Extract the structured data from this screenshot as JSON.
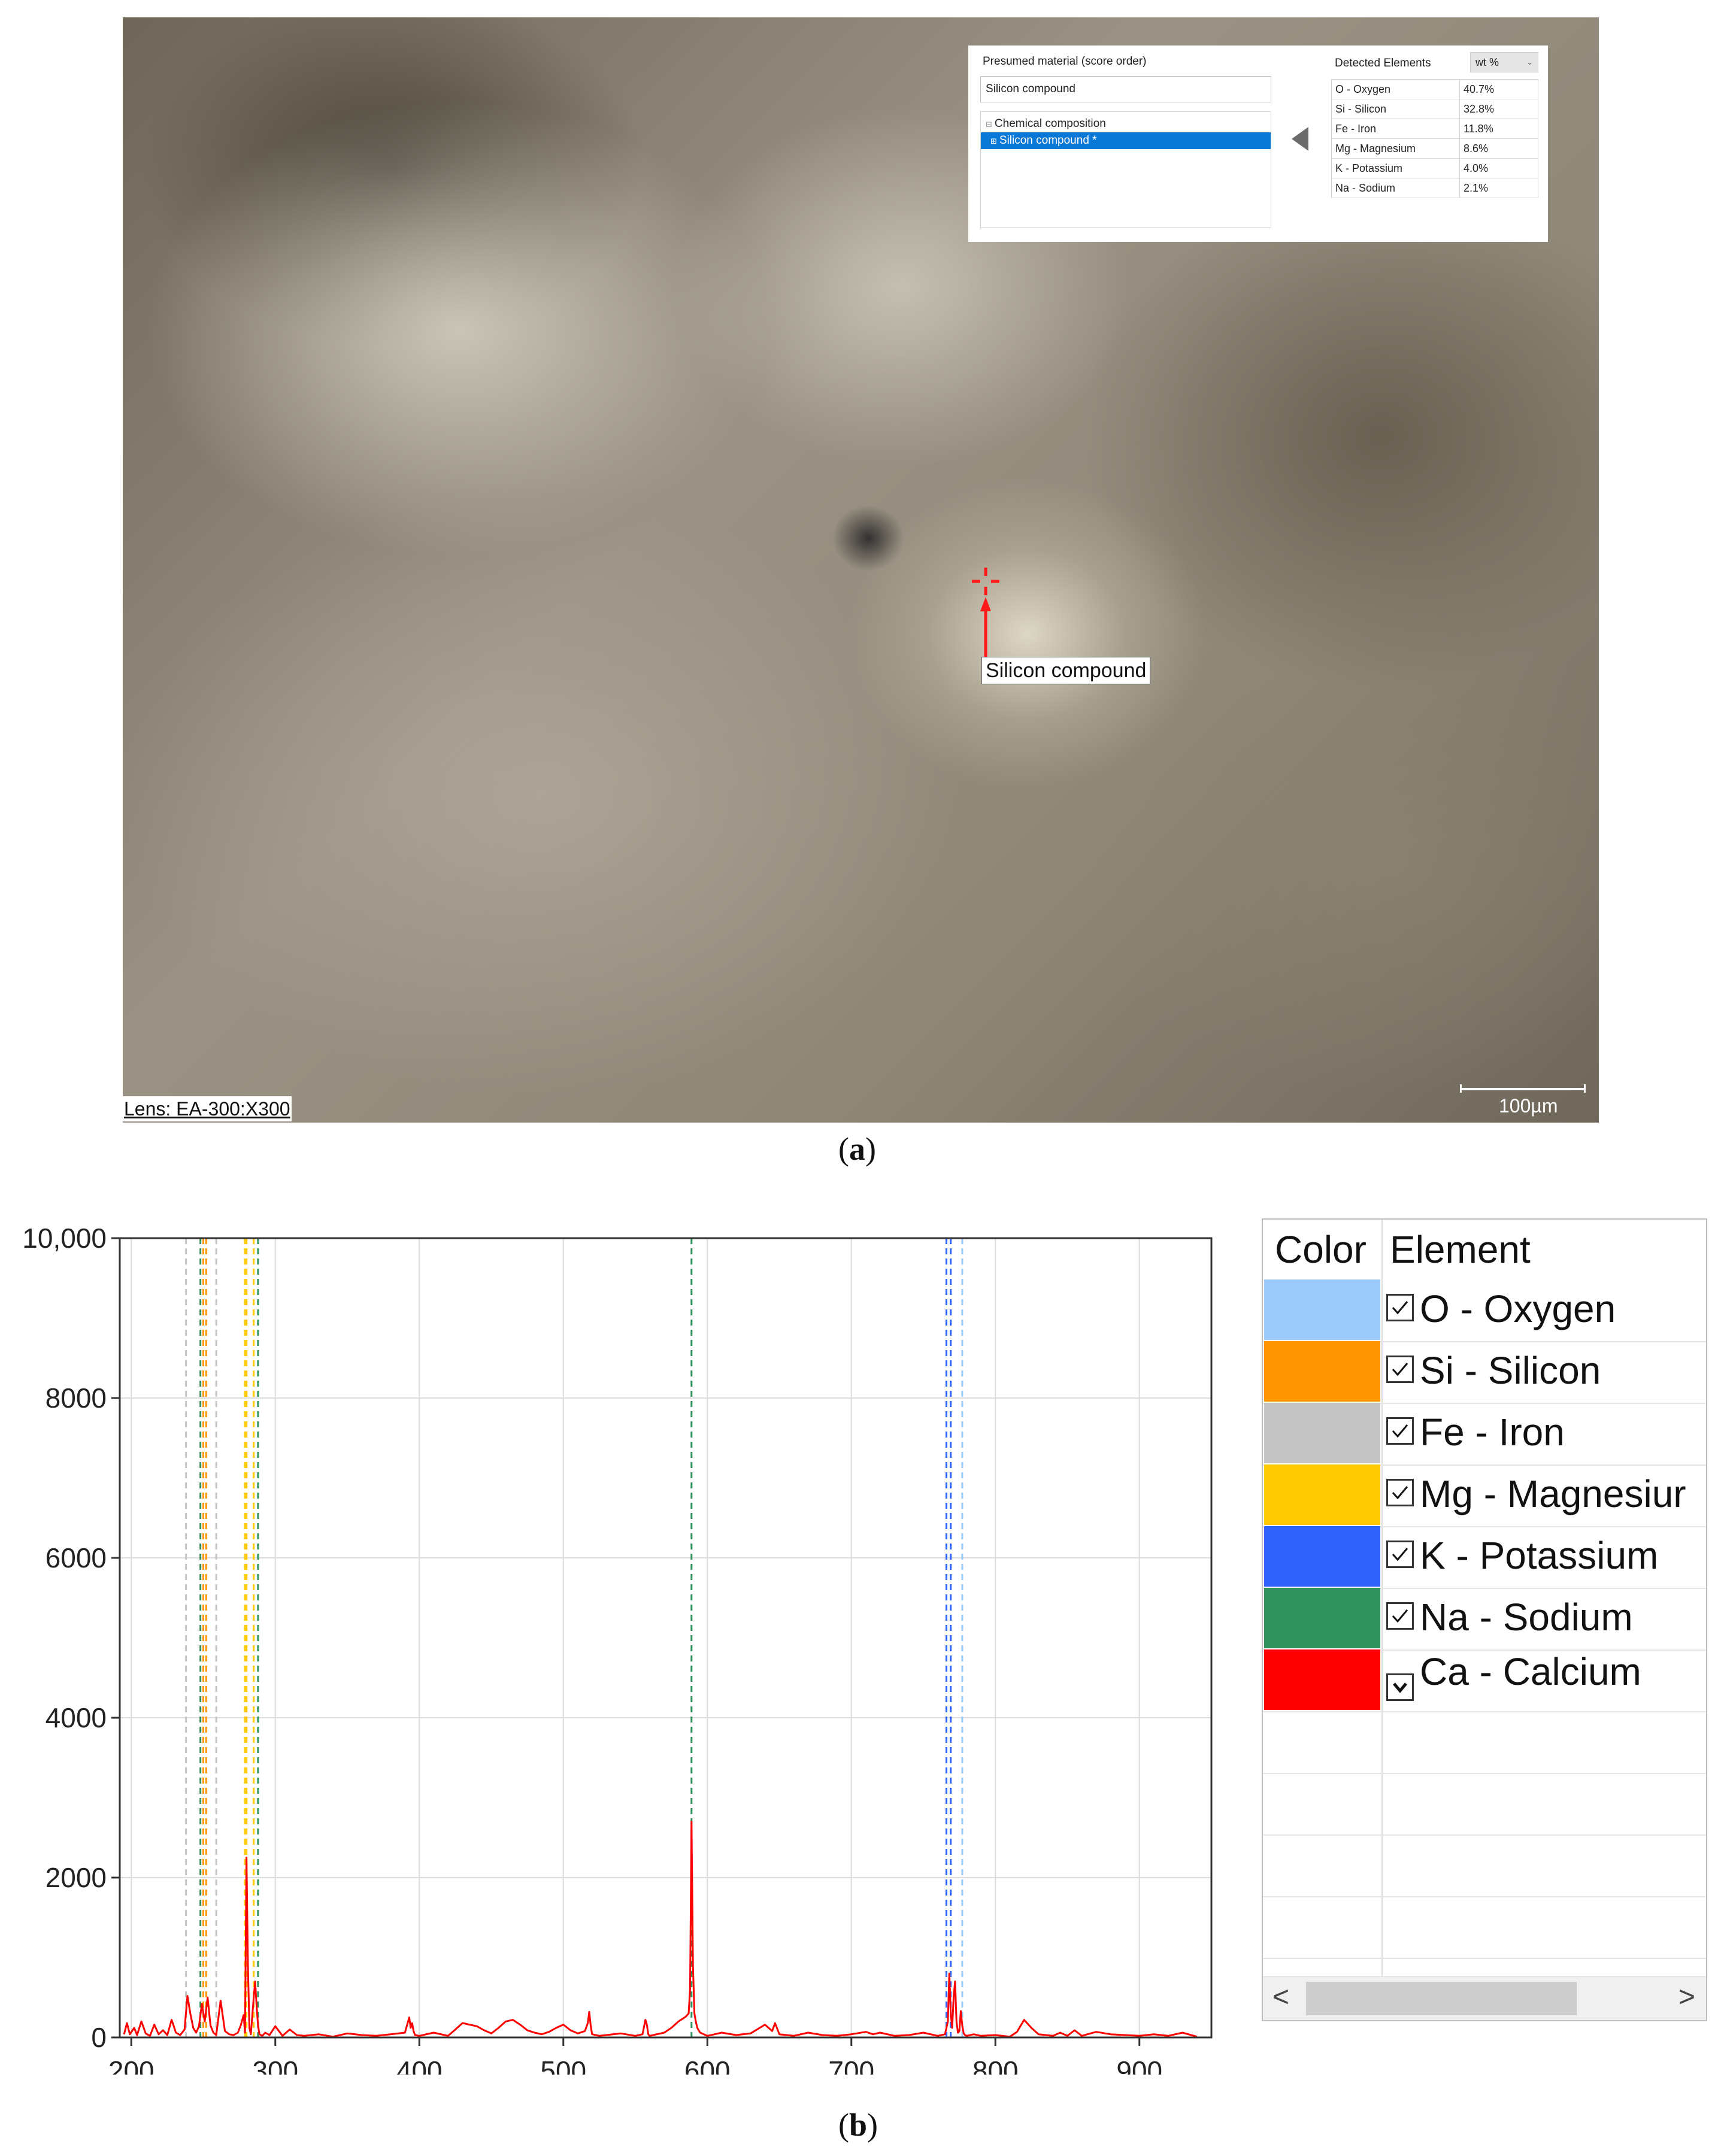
{
  "panel_a": {
    "label": "a",
    "material_panel": {
      "title": "Presumed material (score order)",
      "material_value": "Silicon compound",
      "tree_root": "Chemical composition",
      "tree_selected": "Silicon compound *",
      "detected_title": "Detected Elements",
      "unit": "wt %",
      "elements": [
        {
          "name": "O - Oxygen",
          "value": "40.7%"
        },
        {
          "name": "Si - Silicon",
          "value": "32.8%"
        },
        {
          "name": "Fe - Iron",
          "value": "11.8%"
        },
        {
          "name": "Mg - Magnesium",
          "value": "8.6%"
        },
        {
          "name": "K - Potassium",
          "value": "4.0%"
        },
        {
          "name": "Na - Sodium",
          "value": "2.1%"
        }
      ]
    },
    "annotation": "Silicon compound",
    "lens": "Lens: EA-300:X300",
    "scale": "100µm",
    "colors": {
      "target": "#ff1a1a",
      "selection": "#0a78d7"
    }
  },
  "panel_b": {
    "label": "b",
    "legend": {
      "header_color": "Color",
      "header_element": "Element",
      "rows": [
        {
          "name": "O - Oxygen",
          "color": "#9dcbf9",
          "checked": true
        },
        {
          "name": "Si - Silicon",
          "color": "#ff9500",
          "checked": true
        },
        {
          "name": "Fe - Iron",
          "color": "#c4c4c4",
          "checked": true
        },
        {
          "name": "Mg - Magnesiur",
          "color": "#ffcb00",
          "checked": true
        },
        {
          "name": "K - Potassium",
          "color": "#2f62fb",
          "checked": true
        },
        {
          "name": "Na - Sodium",
          "color": "#30935d",
          "checked": true
        },
        {
          "name": "Ca - Calcium",
          "color": "#ff0000",
          "checked": "expand"
        }
      ],
      "scroll_left": "<",
      "scroll_right": ">"
    }
  },
  "chart_data": {
    "type": "line",
    "title": "",
    "xlabel": "",
    "ylabel": "",
    "xlim": [
      192,
      950
    ],
    "ylim": [
      0,
      10000
    ],
    "x_ticks": [
      200,
      300,
      400,
      500,
      600,
      700,
      800,
      900
    ],
    "y_ticks": [
      0,
      2000,
      4000,
      6000,
      8000,
      10000
    ],
    "x_tick_labels": [
      "200",
      "300",
      "400",
      "500",
      "600",
      "700",
      "800",
      "900"
    ],
    "y_tick_labels": [
      "0",
      "2000",
      "4000",
      "6000",
      "8000",
      "10,000"
    ],
    "grid": true,
    "series": [
      {
        "name": "Ca - Calcium",
        "color": "#ff0000",
        "x": [
          195,
          197,
          199,
          202,
          204,
          207,
          210,
          213,
          216,
          219,
          222,
          225,
          228,
          231,
          234,
          237,
          239,
          241,
          243,
          245,
          247,
          249,
          251,
          253,
          255,
          257,
          259,
          262,
          265,
          268,
          271,
          274,
          276,
          278,
          279,
          280,
          281,
          282,
          283,
          285,
          286,
          287,
          288,
          289,
          291,
          293,
          296,
          300,
          305,
          310,
          315,
          320,
          330,
          340,
          350,
          360,
          370,
          380,
          390,
          393,
          394,
          395,
          396,
          397,
          400,
          410,
          420,
          425,
          430,
          435,
          440,
          445,
          450,
          455,
          460,
          465,
          470,
          475,
          480,
          485,
          490,
          495,
          500,
          505,
          510,
          515,
          517,
          518,
          519,
          520,
          525,
          530,
          540,
          550,
          555,
          557,
          558,
          559,
          560,
          570,
          575,
          580,
          585,
          587,
          588,
          589,
          590,
          591,
          592,
          593,
          595,
          600,
          605,
          610,
          620,
          630,
          640,
          645,
          647,
          650,
          660,
          670,
          680,
          690,
          700,
          710,
          715,
          720,
          730,
          740,
          750,
          760,
          765,
          767,
          768,
          769,
          770,
          771,
          772,
          773,
          774,
          775,
          776,
          777,
          778,
          779,
          780,
          785,
          790,
          800,
          810,
          815,
          820,
          825,
          830,
          840,
          845,
          850,
          855,
          860,
          870,
          880,
          890,
          900,
          910,
          920,
          930,
          940
        ],
        "y": [
          40,
          180,
          40,
          120,
          30,
          200,
          50,
          20,
          160,
          40,
          90,
          30,
          220,
          60,
          30,
          100,
          520,
          300,
          120,
          60,
          140,
          420,
          200,
          500,
          150,
          60,
          30,
          460,
          80,
          40,
          30,
          60,
          150,
          280,
          60,
          2250,
          900,
          120,
          40,
          500,
          700,
          400,
          150,
          40,
          20,
          60,
          30,
          140,
          20,
          100,
          30,
          20,
          40,
          10,
          50,
          30,
          20,
          40,
          60,
          250,
          120,
          180,
          80,
          30,
          20,
          60,
          20,
          100,
          180,
          160,
          140,
          90,
          50,
          120,
          200,
          220,
          160,
          90,
          60,
          40,
          70,
          120,
          160,
          90,
          50,
          80,
          180,
          320,
          150,
          40,
          20,
          30,
          50,
          20,
          40,
          220,
          160,
          40,
          20,
          60,
          120,
          200,
          260,
          300,
          600,
          2700,
          900,
          300,
          200,
          120,
          60,
          20,
          40,
          60,
          30,
          50,
          160,
          80,
          180,
          40,
          20,
          60,
          30,
          20,
          40,
          70,
          40,
          60,
          20,
          30,
          60,
          20,
          40,
          200,
          800,
          300,
          120,
          500,
          700,
          200,
          60,
          80,
          330,
          150,
          50,
          30,
          20,
          40,
          20,
          30,
          10,
          70,
          220,
          120,
          40,
          20,
          60,
          20,
          90,
          20,
          70,
          40,
          30,
          20,
          40,
          20,
          60,
          10
        ]
      }
    ],
    "reference_lines": [
      {
        "x": 238,
        "color": "#c4c4c4"
      },
      {
        "x": 248,
        "color": "#30935d"
      },
      {
        "x": 250,
        "color": "#ff9500"
      },
      {
        "x": 252,
        "color": "#ff9500"
      },
      {
        "x": 259,
        "color": "#c4c4c4"
      },
      {
        "x": 279,
        "color": "#ffcb00"
      },
      {
        "x": 280,
        "color": "#ffcb00"
      },
      {
        "x": 285,
        "color": "#ffcb00"
      },
      {
        "x": 288,
        "color": "#30935d"
      },
      {
        "x": 589,
        "color": "#30935d"
      },
      {
        "x": 766,
        "color": "#2f62fb"
      },
      {
        "x": 769,
        "color": "#2f62fb"
      },
      {
        "x": 777,
        "color": "#9dcbf9"
      }
    ]
  }
}
